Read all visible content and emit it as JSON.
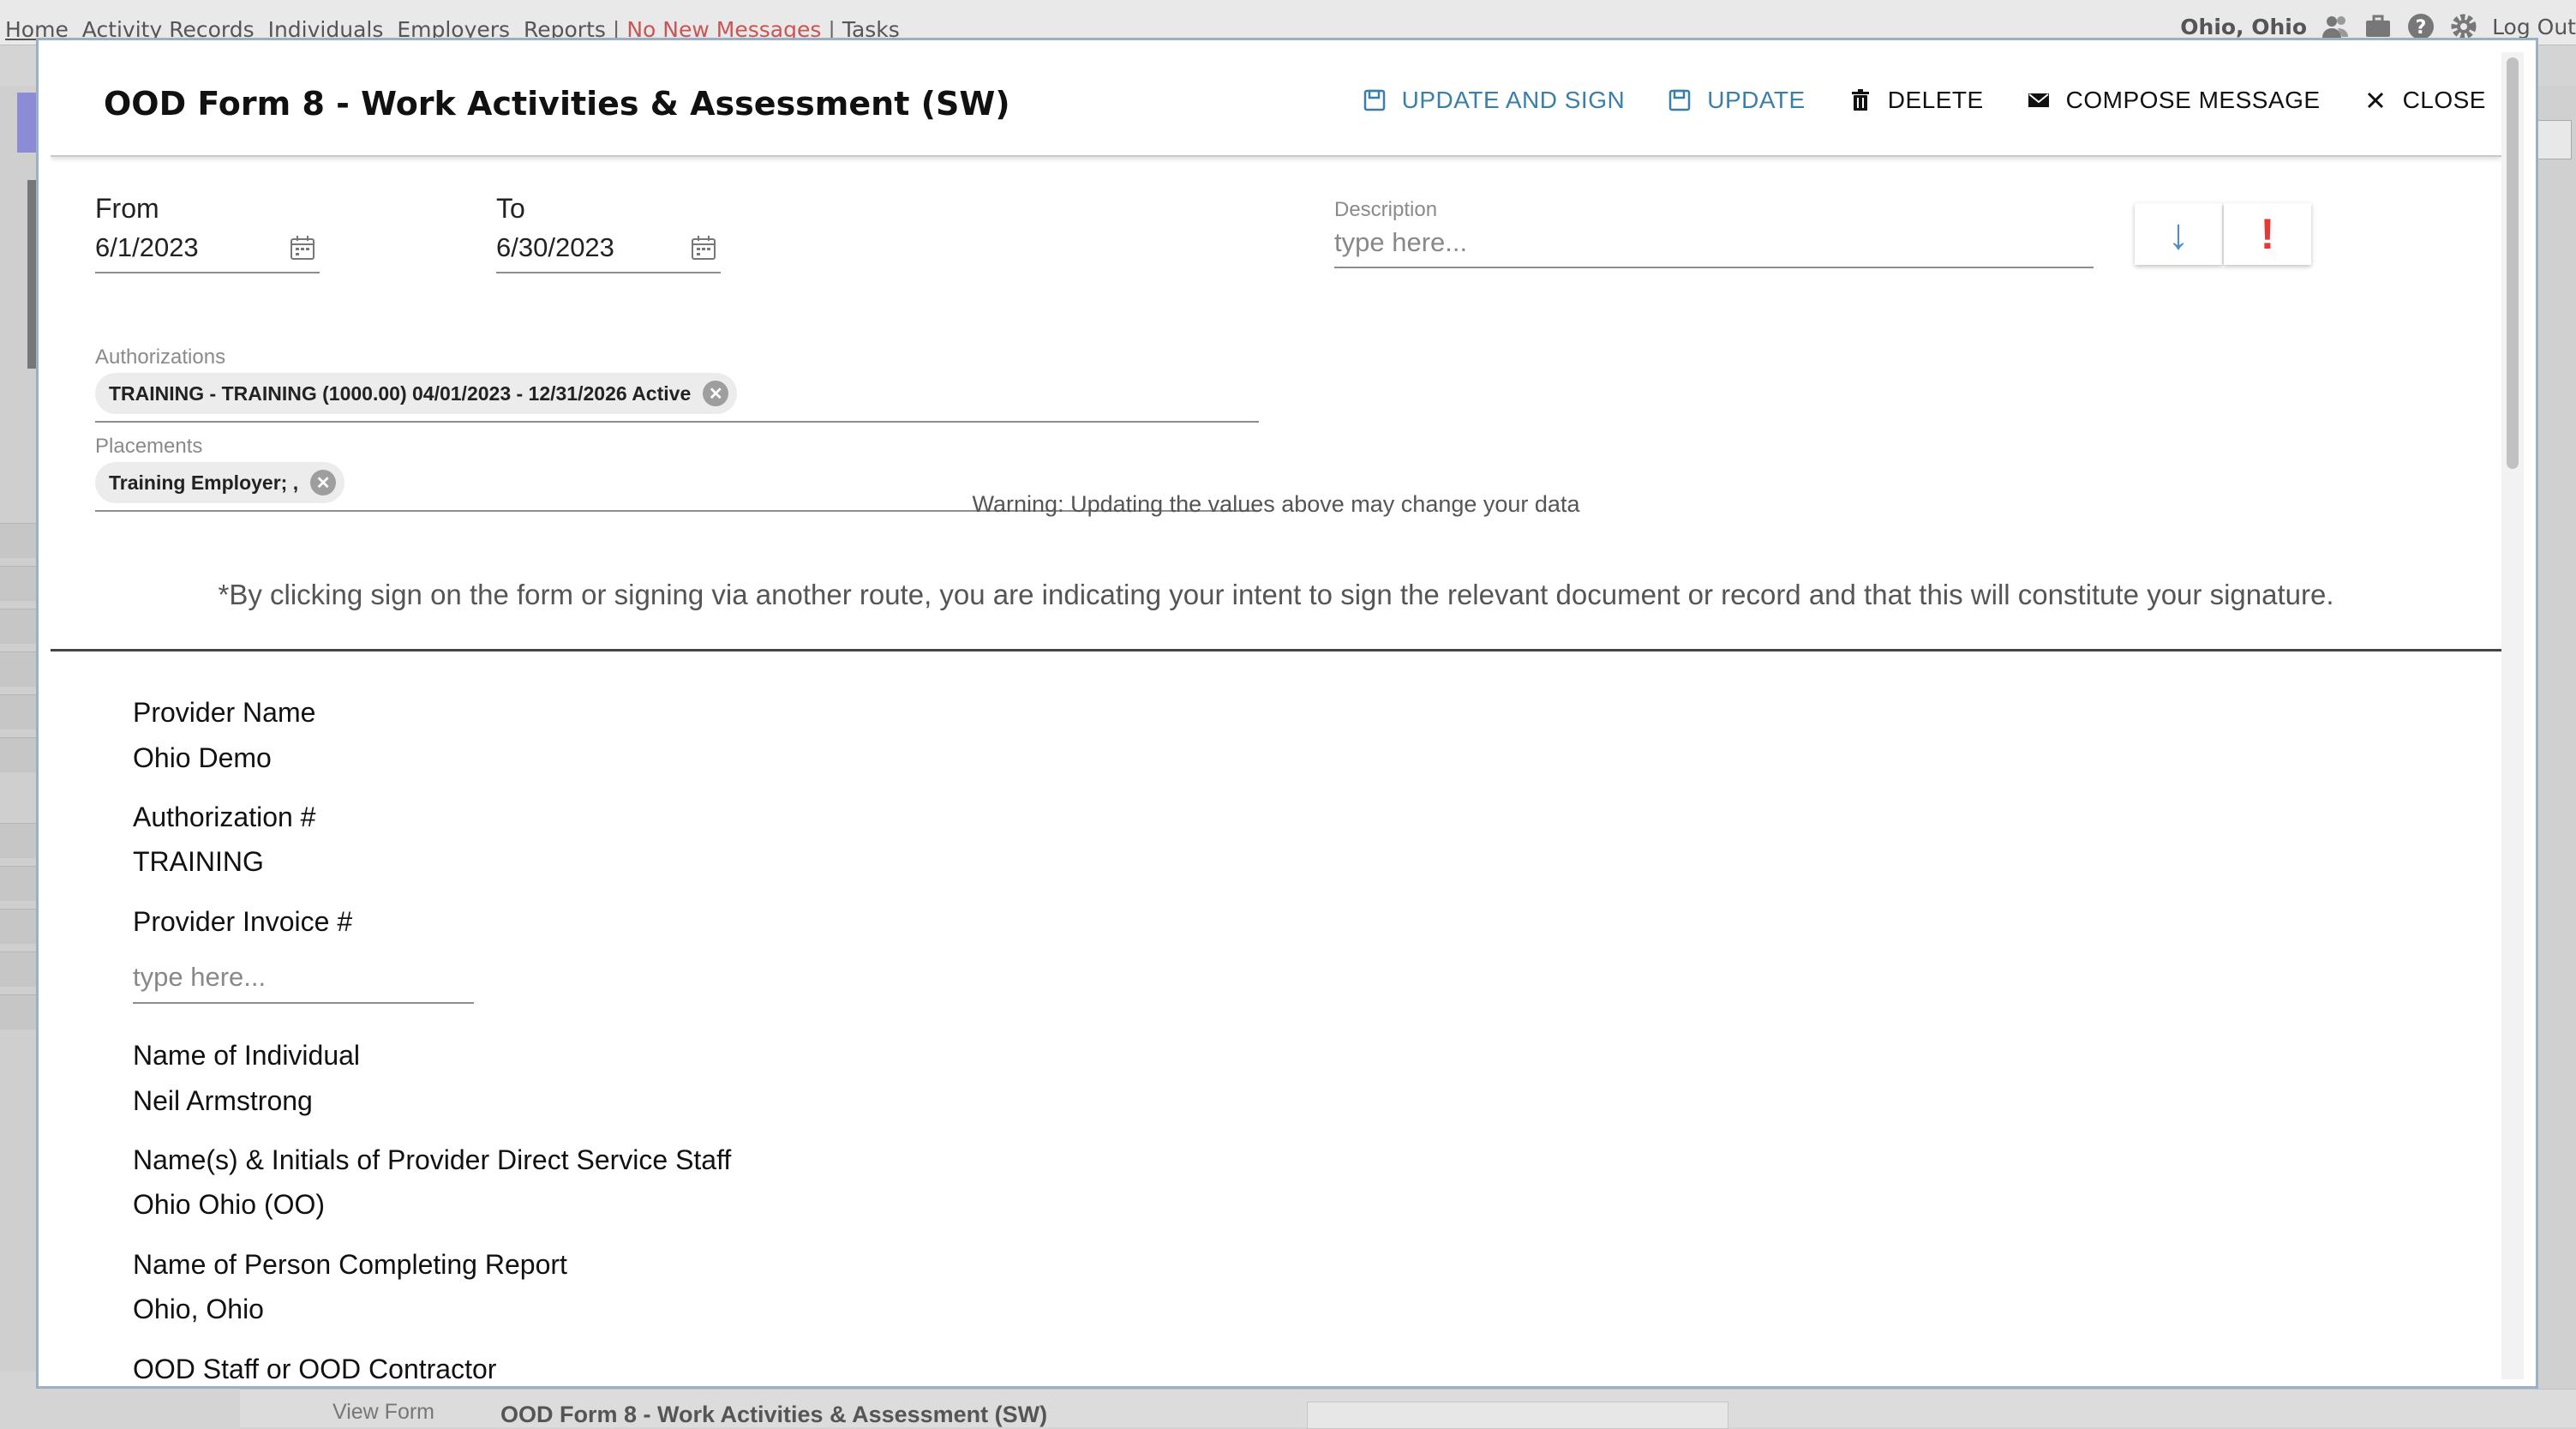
{
  "nav": {
    "links": [
      "Home",
      "Activity Records",
      "Individuals",
      "Employers",
      "Reports"
    ],
    "messages": "No New Messages",
    "tasks": "Tasks",
    "user": "Ohio, Ohio",
    "logout": "Log Out"
  },
  "background": {
    "view_form": "View Form",
    "form_title": "OOD Form 8 - Work Activities & Assessment (SW)"
  },
  "modal": {
    "title": "OOD Form 8 - Work Activities & Assessment (SW)",
    "actions": {
      "update_and_sign": "UPDATE AND SIGN",
      "update": "UPDATE",
      "delete": "DELETE",
      "compose": "COMPOSE MESSAGE",
      "close": "CLOSE"
    },
    "from_label": "From",
    "from_value": "6/1/2023",
    "to_label": "To",
    "to_value": "6/30/2023",
    "description_label": "Description",
    "description_placeholder": "type here...",
    "authorizations_label": "Authorizations",
    "authorization_chip": "TRAINING - TRAINING (1000.00) 04/01/2023 - 12/31/2026 Active",
    "placements_label": "Placements",
    "placement_chip": "Training Employer; ,",
    "warning": "Warning: Updating the values above may change your data",
    "notice": "*By clicking sign on the form or signing via another route, you are indicating your intent to sign the relevant document or record and that this will constitute your signature."
  },
  "form": {
    "provider_name_label": "Provider Name",
    "provider_name": "Ohio Demo",
    "authorization_label": "Authorization #",
    "authorization": "TRAINING",
    "invoice_label": "Provider Invoice #",
    "invoice_placeholder": "type here...",
    "individual_label": "Name of Individual",
    "individual": "Neil Armstrong",
    "staff_label": "Name(s) & Initials of Provider Direct Service Staff",
    "staff": "Ohio Ohio (OO)",
    "completing_label": "Name of Person Completing Report",
    "completing": "Ohio, Ohio",
    "ood_staff_label": "OOD Staff or OOD Contractor"
  },
  "colors": {
    "accent": "#3a7fa8",
    "warning_icon": "#e53935",
    "down_icon": "#4b8fd1",
    "messages_link": "#c85555"
  }
}
